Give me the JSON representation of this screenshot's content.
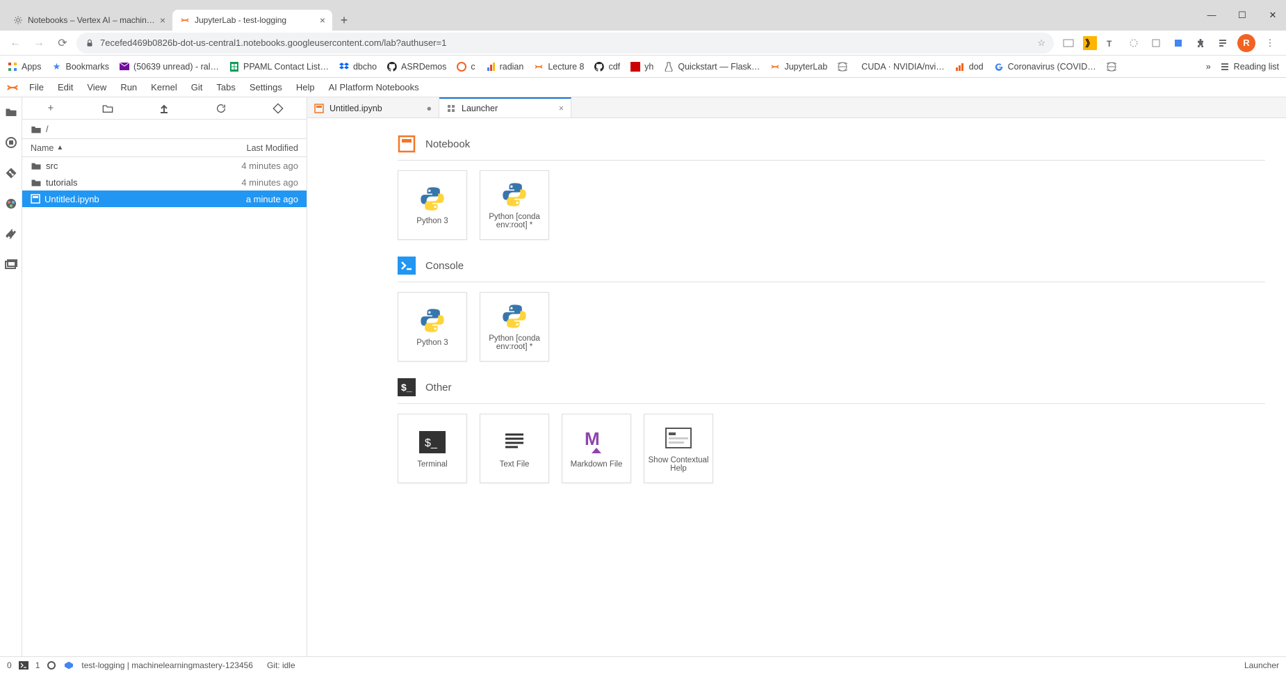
{
  "browser": {
    "tabs": [
      {
        "title": "Notebooks – Vertex AI – machine…",
        "active": false
      },
      {
        "title": "JupyterLab - test-logging",
        "active": true
      }
    ],
    "url": "7ecefed469b0826b-dot-us-central1.notebooks.googleusercontent.com/lab?authuser=1",
    "avatar": "R",
    "bookmarks": [
      {
        "label": "Apps",
        "icon": "grid"
      },
      {
        "label": "Bookmarks",
        "icon": "star"
      },
      {
        "label": "(50639 unread) - ral…",
        "icon": "mail"
      },
      {
        "label": "PPAML Contact List…",
        "icon": "sheet"
      },
      {
        "label": "dbcho",
        "icon": "dropbox"
      },
      {
        "label": "ASRDemos",
        "icon": "github"
      },
      {
        "label": "c",
        "icon": "c"
      },
      {
        "label": "radian",
        "icon": "radian"
      },
      {
        "label": "Lecture 8",
        "icon": "jup"
      },
      {
        "label": "cdf",
        "icon": "github"
      },
      {
        "label": "yh",
        "icon": "cnn"
      },
      {
        "label": "Quickstart — Flask…",
        "icon": "flask"
      },
      {
        "label": "JupyterLab",
        "icon": "jup"
      },
      {
        "label": "",
        "icon": "globe"
      },
      {
        "label": "CUDA · NVIDIA/nvi…",
        "icon": "none"
      },
      {
        "label": "dod",
        "icon": "bars"
      },
      {
        "label": "Coronavirus (COVID…",
        "icon": "google"
      },
      {
        "label": "",
        "icon": "globe"
      }
    ],
    "reading_list": "Reading list"
  },
  "jupyter": {
    "menu": [
      "File",
      "Edit",
      "View",
      "Run",
      "Kernel",
      "Git",
      "Tabs",
      "Settings",
      "Help",
      "AI Platform Notebooks"
    ],
    "breadcrumb": "/",
    "filecols": {
      "name": "Name",
      "modified": "Last Modified"
    },
    "files": [
      {
        "name": "src",
        "type": "folder",
        "modified": "4 minutes ago",
        "selected": false
      },
      {
        "name": "tutorials",
        "type": "folder",
        "modified": "4 minutes ago",
        "selected": false
      },
      {
        "name": "Untitled.ipynb",
        "type": "notebook",
        "modified": "a minute ago",
        "selected": true
      }
    ],
    "doctabs": [
      {
        "label": "Untitled.ipynb",
        "icon": "nb",
        "dirty": true,
        "active": false
      },
      {
        "label": "Launcher",
        "icon": "launch",
        "dirty": false,
        "active": true
      }
    ],
    "launcher": {
      "sections": [
        {
          "title": "Notebook",
          "icon": "nb",
          "cards": [
            {
              "label": "Python 3",
              "icon": "python"
            },
            {
              "label": "Python [conda env:root] *",
              "icon": "python"
            }
          ]
        },
        {
          "title": "Console",
          "icon": "console",
          "cards": [
            {
              "label": "Python 3",
              "icon": "python"
            },
            {
              "label": "Python [conda env:root] *",
              "icon": "python"
            }
          ]
        },
        {
          "title": "Other",
          "icon": "term",
          "cards": [
            {
              "label": "Terminal",
              "icon": "terminal"
            },
            {
              "label": "Text File",
              "icon": "text"
            },
            {
              "label": "Markdown File",
              "icon": "markdown"
            },
            {
              "label": "Show Contextual Help",
              "icon": "help"
            }
          ]
        }
      ]
    },
    "status": {
      "left_counts": {
        "a": "0",
        "b": "1"
      },
      "gcp": "test-logging | machinelearningmastery-123456",
      "git": "Git: idle",
      "right": "Launcher"
    }
  }
}
